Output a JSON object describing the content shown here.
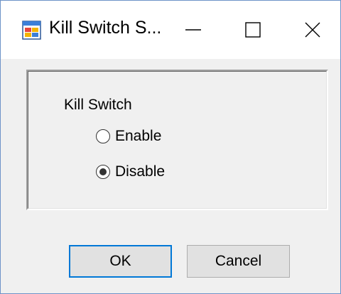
{
  "window": {
    "title": "Kill Switch S...",
    "icon": "app-window-icon",
    "controls": {
      "minimize_icon": "minimize-icon",
      "maximize_icon": "maximize-icon",
      "close_icon": "close-icon"
    }
  },
  "group": {
    "label": "Kill Switch",
    "options": [
      {
        "label": "Enable",
        "selected": false
      },
      {
        "label": "Disable",
        "selected": true
      }
    ]
  },
  "buttons": {
    "ok_label": "OK",
    "cancel_label": "Cancel"
  },
  "colors": {
    "window_border": "#6d93c8",
    "dialog_background": "#f0f0f0",
    "default_button_border": "#0078d7",
    "button_face": "#e1e1e1"
  }
}
